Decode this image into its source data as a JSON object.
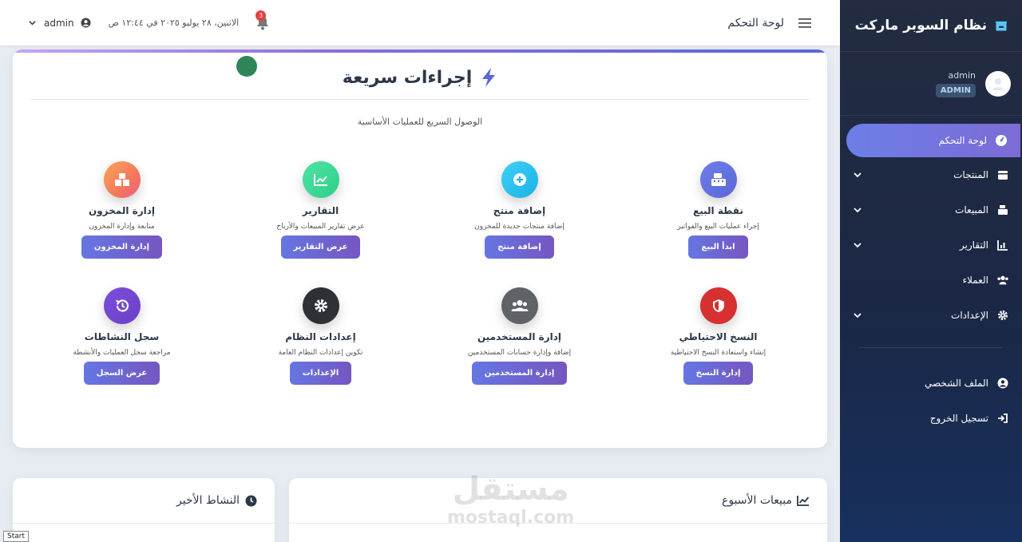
{
  "sidebar": {
    "brand": "نظام السوبر ماركت",
    "user": {
      "name": "admin",
      "role": "ADMIN"
    },
    "items": [
      {
        "label": "لوحة التحكم",
        "icon": "gauge-icon",
        "active": true,
        "expandable": false
      },
      {
        "label": "المنتجات",
        "icon": "box-icon",
        "active": false,
        "expandable": true
      },
      {
        "label": "المبيعات",
        "icon": "cash-register-icon",
        "active": false,
        "expandable": true
      },
      {
        "label": "التقارير",
        "icon": "chart-icon",
        "active": false,
        "expandable": true
      },
      {
        "label": "العملاء",
        "icon": "users-icon",
        "active": false,
        "expandable": false
      },
      {
        "label": "الإعدادات",
        "icon": "gear-icon",
        "active": false,
        "expandable": true
      }
    ],
    "footer_items": [
      {
        "label": "الملف الشخصي",
        "icon": "user-circle-icon"
      },
      {
        "label": "تسجيل الخروج",
        "icon": "logout-icon"
      }
    ]
  },
  "topbar": {
    "page_title": "لوحة التحكم",
    "datetime": "الاثنين، ٢٨ يوليو ٢٠٢٥ في ١٢:٤٤ ص",
    "notifications_count": "3",
    "user": "admin"
  },
  "quick_actions": {
    "title": "إجراءات سريعة",
    "subtitle": "الوصول السريع للعمليات الأساسية",
    "items": [
      {
        "name": "نقطة البيع",
        "desc": "إجراء عمليات البيع والفواتير",
        "button": "ابدأ البيع",
        "icon": "cash-register-icon",
        "color": "#5a67d8"
      },
      {
        "name": "إضافة منتج",
        "desc": "إضافة منتجات جديدة للمخزون",
        "button": "إضافة منتج",
        "icon": "plus-circle-icon",
        "color": "#19b3e6"
      },
      {
        "name": "التقارير",
        "desc": "عرض تقارير المبيعات والأرباح",
        "button": "عرض التقارير",
        "icon": "chart-line-icon",
        "color": "#2ecf8a"
      },
      {
        "name": "إدارة المخزون",
        "desc": "متابعة وإدارة المخزون",
        "button": "إدارة المخزون",
        "icon": "boxes-icon",
        "color": "#f2795a"
      },
      {
        "name": "النسخ الاحتياطي",
        "desc": "إنشاء واستعادة النسخ الاحتياطية",
        "button": "إدارة النسخ",
        "icon": "shield-icon",
        "color": "#d63031"
      },
      {
        "name": "إدارة المستخدمين",
        "desc": "إضافة وإدارة حسابات المستخدمين",
        "button": "إدارة المستخدمين",
        "icon": "users-icon",
        "color": "#5f6368"
      },
      {
        "name": "إعدادات النظام",
        "desc": "تكوين إعدادات النظام العامة",
        "button": "الإعدادات",
        "icon": "gear-icon",
        "color": "#2d3136"
      },
      {
        "name": "سجل النشاطات",
        "desc": "مراجعة سجل العمليات والأنشطة",
        "button": "عرض السجل",
        "icon": "history-icon",
        "color": "#6c3fc9"
      }
    ]
  },
  "weekly_sales": {
    "title": "مبيعات الأسبوع"
  },
  "recent_activity": {
    "title": "النشاط الأخير"
  },
  "watermark": {
    "ar": "مستقل",
    "en": "mostaql.com"
  },
  "taskbar": {
    "start": "Start"
  }
}
